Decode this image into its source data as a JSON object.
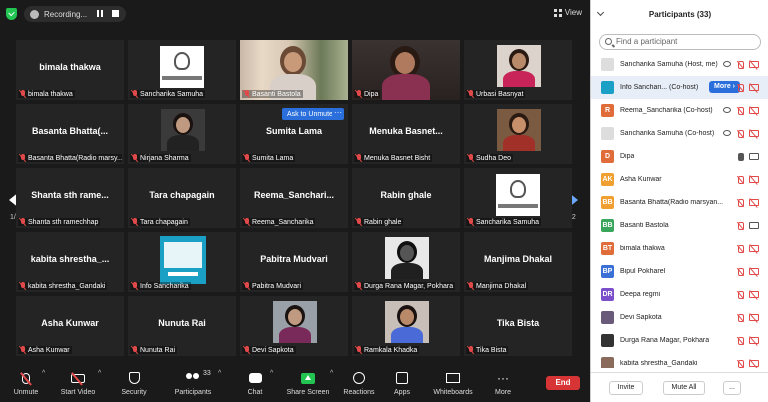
{
  "topbar": {
    "recording_label": "Recording...",
    "view_label": "View"
  },
  "grid": {
    "page_left": "1/2",
    "page_right": "1/2",
    "ask_to_unmute": "Ask to Unmute",
    "ask_more": "···",
    "tiles": [
      {
        "center": "bimala thakwa",
        "label": "bimala thakwa",
        "kind": "name"
      },
      {
        "center": "",
        "label": "Sancharika Samuha",
        "kind": "logo"
      },
      {
        "center": "",
        "label": "Basanti Bastola",
        "kind": "video1"
      },
      {
        "center": "",
        "label": "Dipa",
        "kind": "video2"
      },
      {
        "center": "",
        "label": "Urbasi Basnyat",
        "kind": "photo1"
      },
      {
        "center": "Basanta Bhatta(...",
        "label": "Basanta Bhatta(Radio marsy...",
        "kind": "name"
      },
      {
        "center": "",
        "label": "Nirjana Sharma",
        "kind": "photo2"
      },
      {
        "center": "Sumita Lama",
        "label": "Sumita Lama",
        "kind": "name"
      },
      {
        "center": "Menuka Basnet...",
        "label": "Menuka Basnet Bisht",
        "kind": "name"
      },
      {
        "center": "",
        "label": "Sudha Deo",
        "kind": "photo3"
      },
      {
        "center": "Shanta sth rame...",
        "label": "Shanta sth ramechhap",
        "kind": "name"
      },
      {
        "center": "Tara chapagain",
        "label": "Tara chapagain",
        "kind": "name"
      },
      {
        "center": "Reema_Sanchari...",
        "label": "Reema_Sancharika",
        "kind": "name"
      },
      {
        "center": "Rabin ghale",
        "label": "Rabin ghale",
        "kind": "name"
      },
      {
        "center": "",
        "label": "Sancharika Samuha",
        "kind": "logo"
      },
      {
        "center": "kabita shrestha_...",
        "label": "kabita shrestha_Gandaki",
        "kind": "name"
      },
      {
        "center": "",
        "label": "Info Sancharika",
        "kind": "poster"
      },
      {
        "center": "Pabitra Mudvari",
        "label": "Pabitra Mudvari",
        "kind": "name"
      },
      {
        "center": "",
        "label": "Durga Rana Magar, Pokhara",
        "kind": "photo4"
      },
      {
        "center": "Manjima Dhakal",
        "label": "Manjima Dhakal",
        "kind": "name"
      },
      {
        "center": "Asha Kunwar",
        "label": "Asha Kunwar",
        "kind": "name"
      },
      {
        "center": "Nunuta Rai",
        "label": "Nunuta Rai",
        "kind": "name"
      },
      {
        "center": "",
        "label": "Devi Sapkota",
        "kind": "photo5"
      },
      {
        "center": "",
        "label": "Ramkala Khadka",
        "kind": "photo6"
      },
      {
        "center": "Tika Bista",
        "label": "Tika Bista",
        "kind": "name"
      }
    ]
  },
  "toolbar": {
    "unmute": "Unmute",
    "start_video": "Start Video",
    "security": "Security",
    "participants": "Participants",
    "participants_count": "33",
    "chat": "Chat",
    "share_screen": "Share Screen",
    "reactions": "Reactions",
    "apps": "Apps",
    "whiteboards": "Whiteboards",
    "more": "More",
    "end": "End"
  },
  "panel": {
    "title": "Participants (33)",
    "search_placeholder": "Find a participant",
    "more_button": "More",
    "invite": "Invite",
    "mute_all": "Mute All",
    "foot_more": "...",
    "participants": [
      {
        "initials": "",
        "name": "Sancharika Samuha (Host, me)",
        "avatar_color": "#dddddd",
        "mic": "off",
        "cam": "off",
        "extra": "eye"
      },
      {
        "initials": "",
        "name": "Info Sanchari... (Co-host)",
        "avatar_color": "#1aa0c4",
        "mic": "off",
        "cam": "off",
        "extra": "more"
      },
      {
        "initials": "R",
        "name": "Reema_Sancharika (Co-host)",
        "avatar_color": "#e06c3a",
        "mic": "off",
        "cam": "off",
        "extra": "eye"
      },
      {
        "initials": "",
        "name": "Sancharika Samuha (Co-host)",
        "avatar_color": "#dddddd",
        "mic": "off",
        "cam": "off",
        "extra": "eye"
      },
      {
        "initials": "D",
        "name": "Dipa",
        "avatar_color": "#e06c3a",
        "mic": "on",
        "cam": "on",
        "extra": ""
      },
      {
        "initials": "AK",
        "name": "Asha Kunwar",
        "avatar_color": "#f0a030",
        "mic": "off",
        "cam": "off",
        "extra": ""
      },
      {
        "initials": "BB",
        "name": "Basanta Bhatta(Radio marsyan...",
        "avatar_color": "#f0a030",
        "mic": "off",
        "cam": "off",
        "extra": ""
      },
      {
        "initials": "BB",
        "name": "Basanti Bastola",
        "avatar_color": "#3aa65c",
        "mic": "off",
        "cam": "on",
        "extra": ""
      },
      {
        "initials": "BT",
        "name": "bimala thakwa",
        "avatar_color": "#e06c3a",
        "mic": "off",
        "cam": "off",
        "extra": ""
      },
      {
        "initials": "BP",
        "name": "Bipul Pokharel",
        "avatar_color": "#3a6fd6",
        "mic": "off",
        "cam": "off",
        "extra": ""
      },
      {
        "initials": "DR",
        "name": "Deepa regmi",
        "avatar_color": "#7a4fc9",
        "mic": "off",
        "cam": "off",
        "extra": ""
      },
      {
        "initials": "",
        "name": "Devi Sapkota",
        "avatar_color": "#6a5a7a",
        "mic": "off",
        "cam": "off",
        "extra": ""
      },
      {
        "initials": "",
        "name": "Durga Rana Magar, Pokhara",
        "avatar_color": "#333333",
        "mic": "off",
        "cam": "off",
        "extra": ""
      },
      {
        "initials": "",
        "name": "kabita shrestha_Gandaki",
        "avatar_color": "#8a6a5a",
        "mic": "off",
        "cam": "off",
        "extra": ""
      }
    ]
  }
}
